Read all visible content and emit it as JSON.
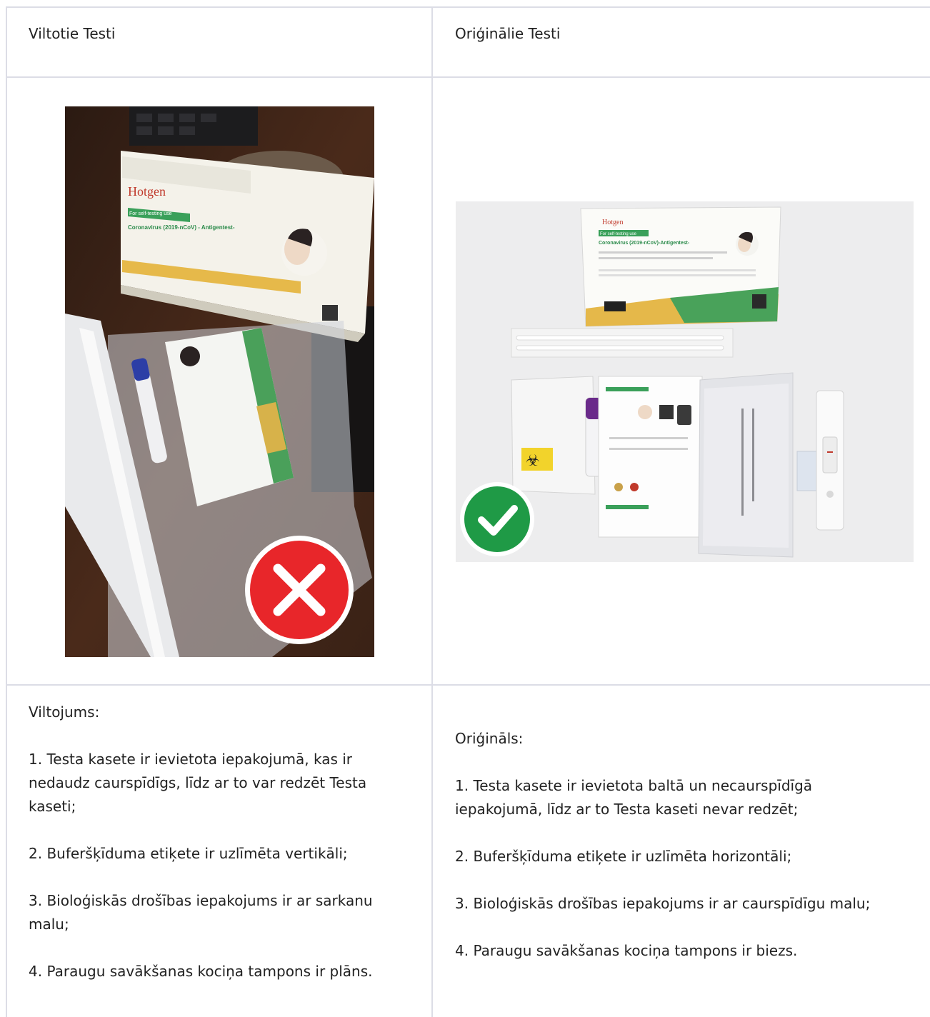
{
  "table": {
    "header": {
      "left": "Viltotie Testi",
      "right": "Oriģinālie Testi"
    },
    "left": {
      "image": {
        "brand": "Hotgen",
        "box_line1": "For self-testing use",
        "box_line2": "Coronavirus (2019-nCoV) - Antigentest-",
        "mark_icon": "red-cross-icon",
        "mark_color": "#e8262a"
      },
      "heading": "Viltojums:",
      "items": [
        "1. Testa kasete ir ievietota iepakojumā, kas ir nedaudz caurspīdīgs, līdz ar to var redzēt Testa kaseti;",
        "2. Buferšķīduma etiķete ir uzlīmēta vertikāli;",
        "3. Bioloģiskās drošības iepakojums ir ar sarkanu malu;",
        "4. Paraugu savākšanas kociņa tampons ir plāns."
      ]
    },
    "right": {
      "image": {
        "brand": "Hotgen",
        "box_line1": "For self-testing use",
        "box_line2": "Coronavirus (2019-nCoV)-Antigentest-",
        "mark_icon": "green-check-icon",
        "mark_color": "#1f9a46"
      },
      "heading": "Oriģināls:",
      "items": [
        "1. Testa kasete ir ievietota baltā un necaurspīdīgā iepakojumā, līdz ar to Testa kaseti nevar redzēt;",
        "2.  Buferšķīduma etiķete ir uzlīmēta horizontāli;",
        "3. Bioloģiskās drošības iepakojums ir ar caurspīdīgu malu;",
        "4. Paraugu savākšanas kociņa tampons ir biezs."
      ]
    }
  }
}
